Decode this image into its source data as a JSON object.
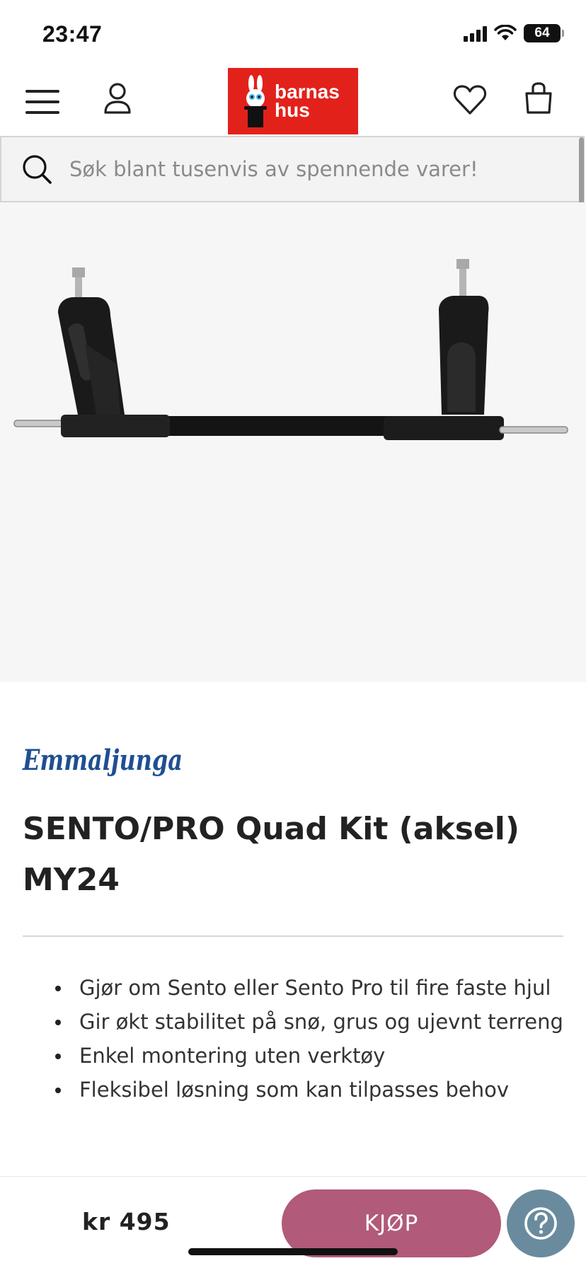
{
  "status_bar": {
    "time": "23:47",
    "battery": "64",
    "icons": [
      "signal-icon",
      "wifi-icon",
      "battery-icon"
    ]
  },
  "header": {
    "icons": [
      "menu-icon",
      "account-icon",
      "heart-icon",
      "shopping-bag-icon"
    ],
    "logo": {
      "line1": "barnas",
      "line2": "hus",
      "color": "#e3211b"
    }
  },
  "search": {
    "placeholder": "Søk blant tusenvis av spennende varer!"
  },
  "product": {
    "brand": "Emmaljunga",
    "brand_color": "#1f4f92",
    "title": "SENTO/PRO Quad Kit (aksel) MY24",
    "features": [
      "Gjør om Sento eller Sento Pro til fire faste hjul",
      "Gir økt stabilitet på snø, grus og ujevnt terreng",
      "Enkel montering uten verktøy",
      "Fleksibel løsning som kan tilpasses behov"
    ]
  },
  "bottom_bar": {
    "price": "kr 495",
    "buy_label": "KJØP",
    "buy_color": "#b15a79",
    "help_color": "#6a8b9e"
  }
}
